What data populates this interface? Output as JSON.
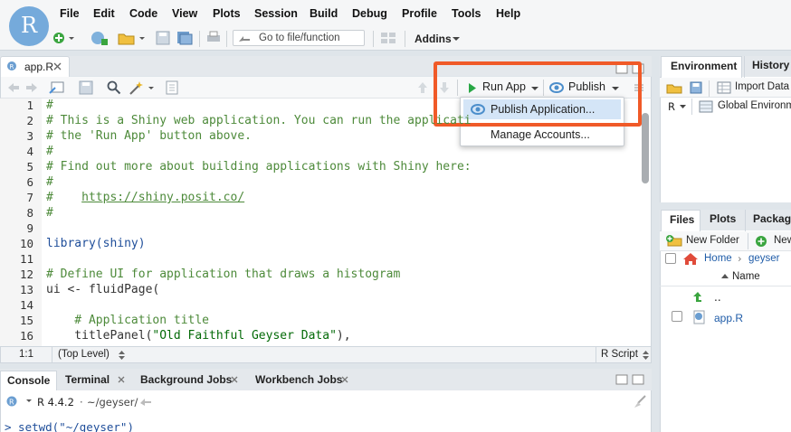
{
  "logo": {
    "letter": "R"
  },
  "menu": [
    "File",
    "Edit",
    "Code",
    "View",
    "Plots",
    "Session",
    "Build",
    "Debug",
    "Profile",
    "Tools",
    "Help"
  ],
  "toolbar": {
    "goto_placeholder": "Go to file/function",
    "addins_label": "Addins"
  },
  "source": {
    "tab_label": "app.R",
    "run_app_label": "Run App",
    "publish_label": "Publish",
    "status_position": "1:1",
    "status_scope": "(Top Level)",
    "status_filetype": "R Script"
  },
  "editor_lines": [
    {
      "n": "1",
      "text": "#"
    },
    {
      "n": "2",
      "text": "# This is a Shiny web application. You can run the applicati"
    },
    {
      "n": "3",
      "text": "# the 'Run App' button above."
    },
    {
      "n": "4",
      "text": "#"
    },
    {
      "n": "5",
      "text": "# Find out more about building applications with Shiny here:"
    },
    {
      "n": "6",
      "text": "#"
    },
    {
      "n": "7",
      "text": "#    https://shiny.posit.co/"
    },
    {
      "n": "8",
      "text": "#"
    },
    {
      "n": "9",
      "text": ""
    },
    {
      "n": "10",
      "text": "library(shiny)"
    },
    {
      "n": "11",
      "text": ""
    },
    {
      "n": "12",
      "text": "# Define UI for application that draws a histogram"
    },
    {
      "n": "13",
      "text": "ui <- fluidPage("
    },
    {
      "n": "14",
      "text": ""
    },
    {
      "n": "15",
      "text": "    # Application title"
    },
    {
      "n": "16",
      "text": "    titlePanel(\"Old Faithful Geyser Data\"),"
    }
  ],
  "dropdown": {
    "publish_application": "Publish Application...",
    "manage_accounts": "Manage Accounts..."
  },
  "console": {
    "tabs": [
      "Console",
      "Terminal",
      "Background Jobs",
      "Workbench Jobs"
    ],
    "r_version": "R 4.4.2",
    "path": "~/geyser/",
    "command": "> setwd(\"~/geyser\")"
  },
  "env": {
    "tabs": [
      "Environment",
      "History"
    ],
    "import_label": "Import Data",
    "r_label": "R",
    "global_env_label": "Global Environment"
  },
  "files": {
    "tabs": [
      "Files",
      "Plots",
      "Packages"
    ],
    "new_folder_label": "New Folder",
    "new_label": "New",
    "breadcrumb_home": "Home",
    "breadcrumb_folder": "geyser",
    "name_header": "Name",
    "parent_label": "..",
    "file_app": "app.R"
  },
  "colors": {
    "highlight": "#f05a28",
    "r_blue": "#75aadb",
    "publish_blue": "#4c8ecb",
    "run_green": "#28a745"
  }
}
